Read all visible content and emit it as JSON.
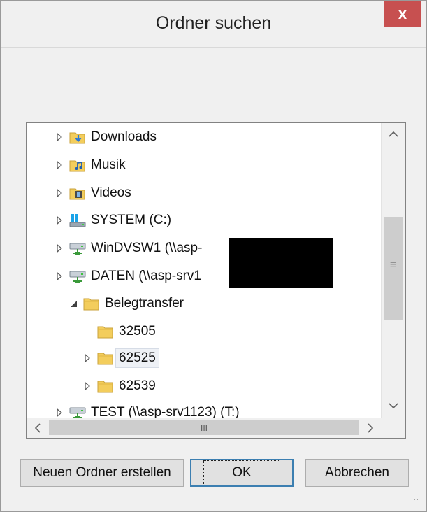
{
  "window": {
    "title": "Ordner suchen",
    "close_label": "x"
  },
  "tree": {
    "items": [
      {
        "label": "Downloads",
        "icon": "downloads-folder-icon",
        "expander": "collapsed",
        "indent": 0
      },
      {
        "label": "Musik",
        "icon": "music-folder-icon",
        "expander": "collapsed",
        "indent": 0
      },
      {
        "label": "Videos",
        "icon": "videos-folder-icon",
        "expander": "collapsed",
        "indent": 0
      },
      {
        "label": "SYSTEM (C:)",
        "icon": "system-drive-icon",
        "expander": "collapsed",
        "indent": 0
      },
      {
        "label": "WinDVSW1 (\\\\asp-",
        "icon": "network-drive-icon",
        "expander": "collapsed",
        "indent": 0
      },
      {
        "label": "DATEN (\\\\asp-srv1",
        "icon": "network-drive-icon",
        "expander": "collapsed",
        "indent": 0
      },
      {
        "label": "Belegtransfer",
        "icon": "folder-icon",
        "expander": "expanded",
        "indent": 1
      },
      {
        "label": "32505",
        "icon": "folder-icon",
        "expander": "none",
        "indent": 2
      },
      {
        "label": "62525",
        "icon": "folder-icon",
        "expander": "collapsed",
        "indent": 2,
        "selected": true
      },
      {
        "label": "62539",
        "icon": "folder-icon",
        "expander": "collapsed",
        "indent": 2
      },
      {
        "label": "TEST (\\\\asp-srv1123) (T:)",
        "icon": "network-drive-icon",
        "expander": "collapsed",
        "indent": 0
      }
    ]
  },
  "scrollbar": {
    "up": "^",
    "down": "v",
    "left": "<",
    "right": ">",
    "v_grip": "≡",
    "h_grip": "III"
  },
  "buttons": {
    "new_folder": "Neuen Ordner erstellen",
    "ok": "OK",
    "cancel": "Abbrechen"
  }
}
